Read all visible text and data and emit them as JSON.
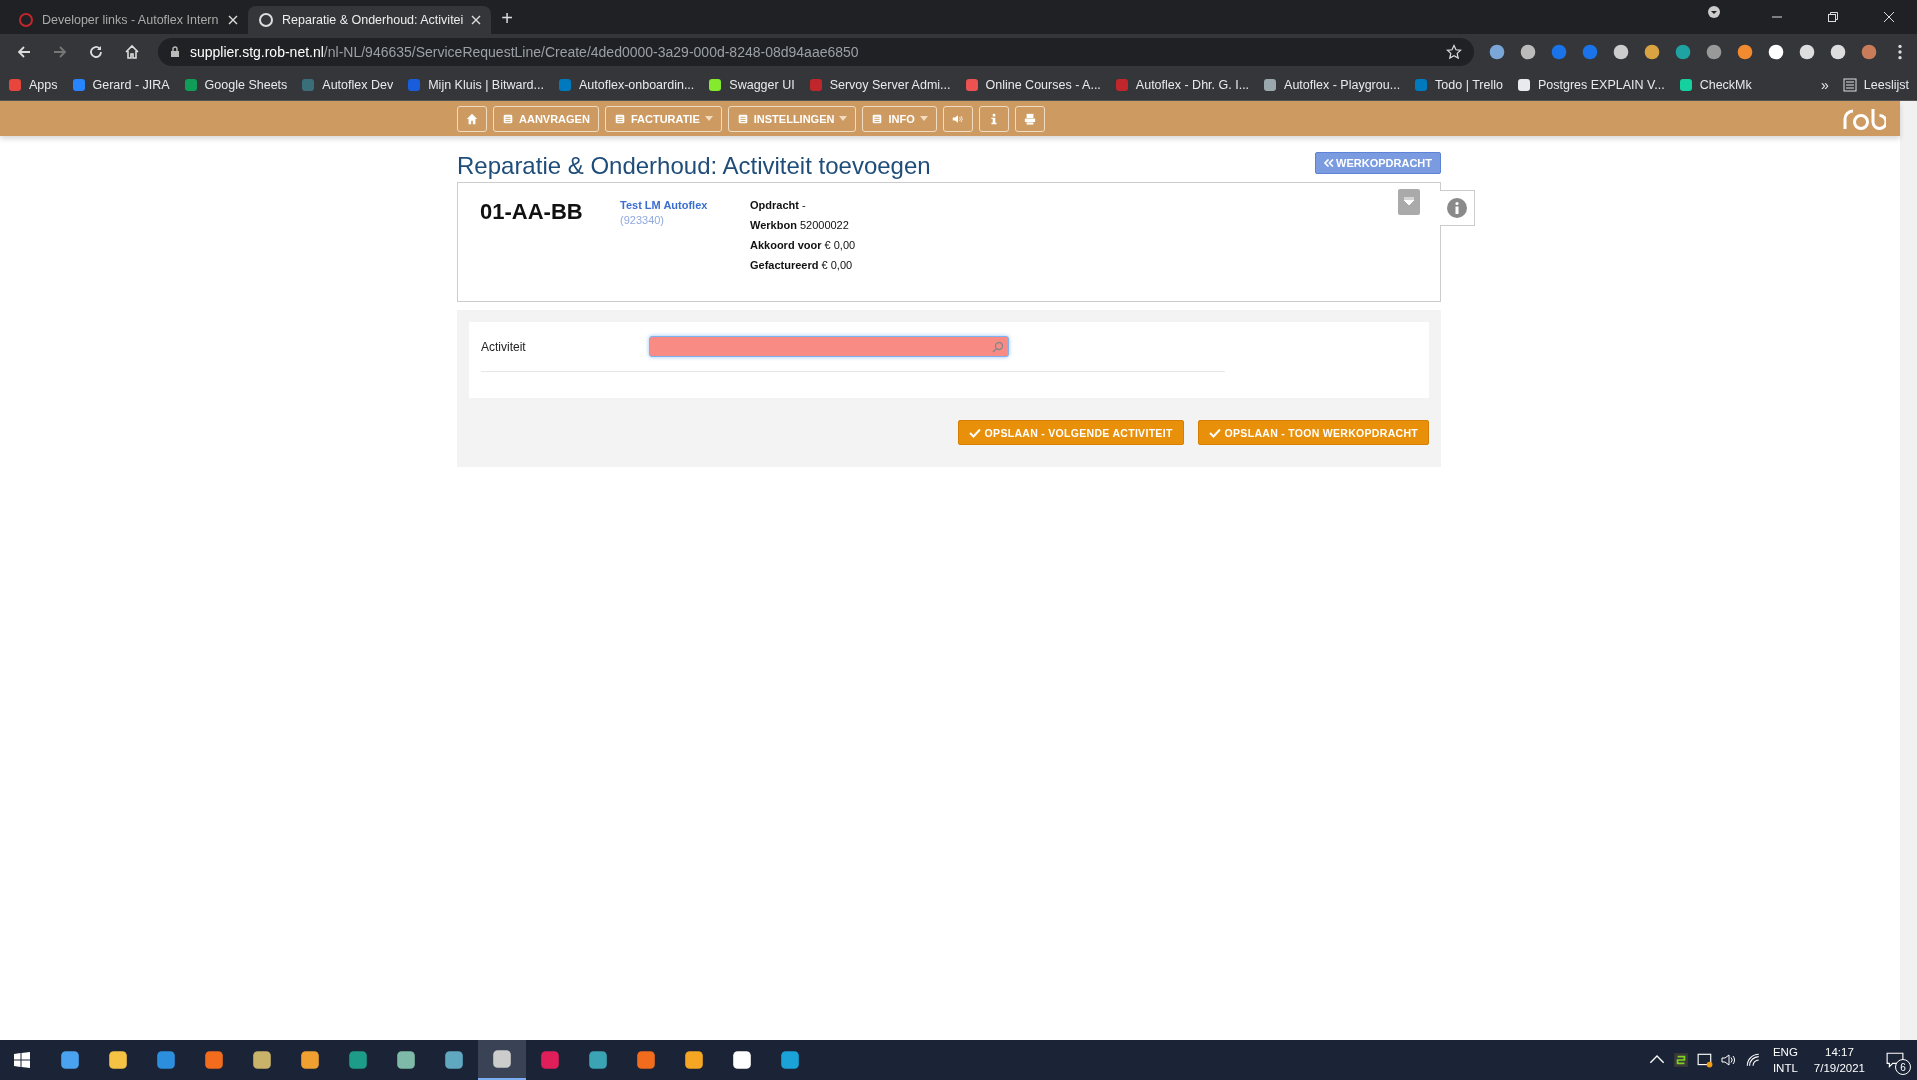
{
  "browser": {
    "tabs": [
      {
        "title": "Developer links - Autoflex Intern",
        "selected": false
      },
      {
        "title": "Reparatie & Onderhoud: Activitei",
        "selected": true
      }
    ],
    "new_tab": "+",
    "url": {
      "host": "supplier.stg.rob-net.nl",
      "path": "/nl-NL/946635/ServiceRequestLine/Create/4ded0000-3a29-000d-8248-08d94aae6850"
    },
    "bookmarks": [
      {
        "label": "Apps",
        "color": "#e8453c"
      },
      {
        "label": "Gerard - JIRA",
        "color": "#2684ff"
      },
      {
        "label": "Google Sheets",
        "color": "#0f9d58"
      },
      {
        "label": "Autoflex Dev",
        "color": "#3a6f7a"
      },
      {
        "label": "Mijn Kluis | Bitward...",
        "color": "#175ddc"
      },
      {
        "label": "Autoflex-onboardin...",
        "color": "#0079bf"
      },
      {
        "label": "Swagger UI",
        "color": "#85ea2d"
      },
      {
        "label": "Servoy Server Admi...",
        "color": "#c0272d"
      },
      {
        "label": "Online Courses - A...",
        "color": "#ec5252"
      },
      {
        "label": "Autoflex - Dhr. G. I...",
        "color": "#c0272d"
      },
      {
        "label": "Autoflex - Playgrou...",
        "color": "#9aa7ad"
      },
      {
        "label": "Todo | Trello",
        "color": "#0079bf"
      },
      {
        "label": "Postgres EXPLAIN V...",
        "color": "#e8eaed"
      },
      {
        "label": "CheckMk",
        "color": "#15d1a0"
      }
    ],
    "more": "»",
    "reading_list": "Leeslijst"
  },
  "nav": [
    {
      "label": "AANVRAGEN",
      "dropdown": false
    },
    {
      "label": "FACTURATIE",
      "dropdown": true
    },
    {
      "label": "INSTELLINGEN",
      "dropdown": true
    },
    {
      "label": "INFO",
      "dropdown": true
    }
  ],
  "page": {
    "title": "Reparatie & Onderhoud: Activiteit toevoegen",
    "back_button": "WERKOPDRACHT",
    "vehicle": {
      "plate": "01-AA-BB",
      "customer": "Test LM Autoflex",
      "customer_id": "(923340)",
      "details": [
        "**Opdracht** -",
        "**Werkbon** 52000022",
        "**Akkoord voor** € 0,00",
        "**Gefactureerd** € 0,00"
      ]
    },
    "form": {
      "label": "Activiteit",
      "invalid": true
    },
    "buttons": [
      "OPSLAAN - VOLGENDE ACTIVITEIT",
      "OPSLAAN - TOON WERKOPDRACHT"
    ]
  },
  "taskbar": {
    "apps": [
      {
        "selected": false
      },
      {
        "selected": false
      },
      {
        "selected": false
      },
      {
        "selected": false
      },
      {
        "selected": false
      },
      {
        "selected": false
      },
      {
        "selected": false
      },
      {
        "selected": false
      },
      {
        "selected": false
      },
      {
        "selected": true
      },
      {
        "selected": false
      },
      {
        "selected": false
      },
      {
        "selected": false
      },
      {
        "selected": false
      },
      {
        "selected": false
      },
      {
        "selected": false
      }
    ],
    "language": "ENG",
    "layout": "INTL",
    "time": "14:17",
    "date": "7/19/2021",
    "notifications": "6"
  }
}
